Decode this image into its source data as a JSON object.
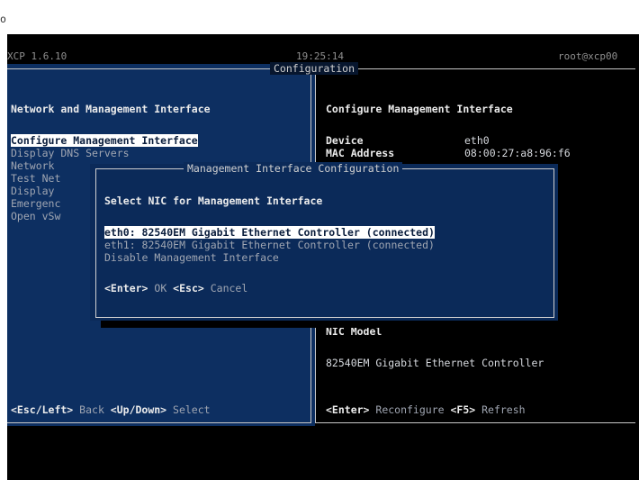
{
  "top_marker": "o",
  "header": {
    "app": "XCP 1.6.10",
    "time": "19:25:14",
    "user": "root@xcp00"
  },
  "main_title": "Configuration",
  "left": {
    "title": "Network and Management Interface",
    "items": [
      "Configure Management Interface",
      "Display DNS Servers",
      "Network",
      "Test Net",
      "Display",
      "Emergenc",
      "Open vSw"
    ],
    "footer": {
      "k1": "<Esc/Left>",
      "t1": " Back ",
      "k2": "<Up/Down>",
      "t2": " Select"
    }
  },
  "right": {
    "title": "Configure Management Interface",
    "device_label": "Device",
    "device_value": "eth0",
    "mac_label": "MAC Address",
    "mac_value": "08:00:27:a8:96:f6",
    "nic_model_label": "NIC Model",
    "nic_model_value": "82540EM Gigabit Ethernet Controller",
    "footer": {
      "k1": "<Enter>",
      "t1": " Reconfigure ",
      "k2": "<F5>",
      "t2": " Refresh"
    }
  },
  "dialog": {
    "title": "Management Interface Configuration",
    "heading": "Select NIC for Management Interface",
    "options": [
      "eth0: 82540EM Gigabit Ethernet Controller (connected)",
      "eth1: 82540EM Gigabit Ethernet Controller (connected)",
      "Disable Management Interface"
    ],
    "footer": {
      "k1": "<Enter>",
      "t1": " OK ",
      "k2": "<Esc>",
      "t2": " Cancel"
    }
  },
  "colors": {
    "panel_blue": "#0d2f61",
    "terminal_black": "#000000",
    "highlight": "#ffffff"
  }
}
